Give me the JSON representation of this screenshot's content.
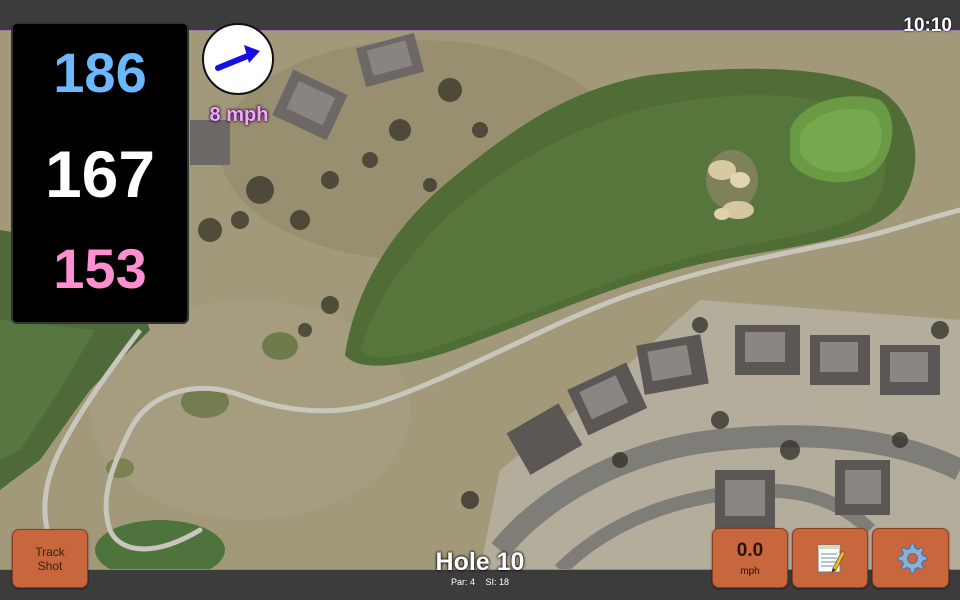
{
  "status": {
    "time": "10:10"
  },
  "yardages": {
    "back": "186",
    "center": "167",
    "front": "153",
    "colors": {
      "back": "#6cb8ff",
      "center": "#ffffff",
      "front": "#ff8fd0"
    }
  },
  "wind": {
    "speed_label": "8 mph",
    "arrow_icon": "wind-direction-arrow-icon",
    "arrow_color": "#1510e0"
  },
  "hole": {
    "title": "Hole 10",
    "par": "Par: 4",
    "si": "SI: 18"
  },
  "buttons": {
    "track_shot": {
      "line1": "Track",
      "line2": "Shot"
    },
    "wind_speed": {
      "value": "0.0",
      "unit": "mph"
    },
    "notes": {
      "icon": "notepad-icon"
    },
    "settings": {
      "icon": "gear-icon"
    }
  },
  "theme": {
    "accent": "#c8673e",
    "bar": "#3c3c3c"
  }
}
